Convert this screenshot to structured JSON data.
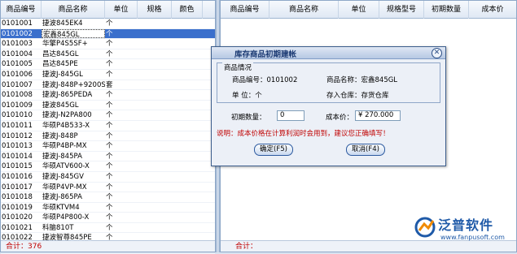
{
  "left_table": {
    "columns": [
      "商品编号",
      "商品名称",
      "单位",
      "规格",
      "颜色"
    ],
    "rows": [
      {
        "code": "0101001",
        "name": "捷波845EK4",
        "unit": "个"
      },
      {
        "code": "0101002",
        "name": "宏鑫845GL",
        "unit": "个"
      },
      {
        "code": "0101003",
        "name": "华擎P4S5SF+",
        "unit": "个"
      },
      {
        "code": "0101004",
        "name": "昌达845GL",
        "unit": "个"
      },
      {
        "code": "0101005",
        "name": "昌达845PE",
        "unit": "个"
      },
      {
        "code": "0101006",
        "name": "捷波J-845GL",
        "unit": "个"
      },
      {
        "code": "0101007",
        "name": "捷波J-848P+9200SE/1",
        "unit": "套"
      },
      {
        "code": "0101008",
        "name": "捷波J-865PEDA",
        "unit": "个"
      },
      {
        "code": "0101009",
        "name": "捷波845GL",
        "unit": "个"
      },
      {
        "code": "0101010",
        "name": "捷波J-N2PA800",
        "unit": "个"
      },
      {
        "code": "0101011",
        "name": "华硕P4B533-X",
        "unit": "个"
      },
      {
        "code": "0101012",
        "name": "捷波J-848P",
        "unit": "个"
      },
      {
        "code": "0101013",
        "name": "华硕P4BP-MX",
        "unit": "个"
      },
      {
        "code": "0101014",
        "name": "捷波J-845PA",
        "unit": "个"
      },
      {
        "code": "0101015",
        "name": "华硕ATV600-X",
        "unit": "个"
      },
      {
        "code": "0101016",
        "name": "捷波J-845GV",
        "unit": "个"
      },
      {
        "code": "0101017",
        "name": "华硕P4VP-MX",
        "unit": "个"
      },
      {
        "code": "0101018",
        "name": "捷波J-865PA",
        "unit": "个"
      },
      {
        "code": "0101019",
        "name": "华硕KTVM4",
        "unit": "个"
      },
      {
        "code": "0101020",
        "name": "华硕P4P800-X",
        "unit": "个"
      },
      {
        "code": "0101021",
        "name": "科脑810T",
        "unit": "个"
      },
      {
        "code": "0101022",
        "name": "捷波智尊845PE",
        "unit": "个"
      },
      {
        "code": "0101023",
        "name": "捷波智尊865PE",
        "unit": "个"
      }
    ],
    "selected_code": "0101002",
    "footer": "合计：376"
  },
  "right_table": {
    "columns": [
      "商品编号",
      "商品名称",
      "单位",
      "规格型号",
      "初期数量",
      "成本价"
    ],
    "footer": "合计："
  },
  "dialog": {
    "title": "库存商品初期建帐",
    "close_glyph": "✕",
    "info_legend": "商品情况",
    "code_text": "商品编号：0101002",
    "name_text": "商品名称：宏鑫845GL",
    "unit_text": "单      位：个",
    "warehouse_text": "存入仓库：存货仓库",
    "qty_label": "初期数量：",
    "qty_value": "0",
    "cost_label": "成本价：",
    "cost_value": "¥ 270.000",
    "note": "说明：成本价格在计算利润时会用到，建议您正确填写！",
    "ok_label": "确定(F5)",
    "cancel_label": "取消(F4)"
  },
  "logo": {
    "brand": "泛普软件",
    "url": "www.fanpusoft.com"
  },
  "colors": {
    "selection": "#3a6fcc",
    "footer_red": "#c00000",
    "brand_blue": "#1f5aa8",
    "brand_orange": "#f08a00"
  }
}
